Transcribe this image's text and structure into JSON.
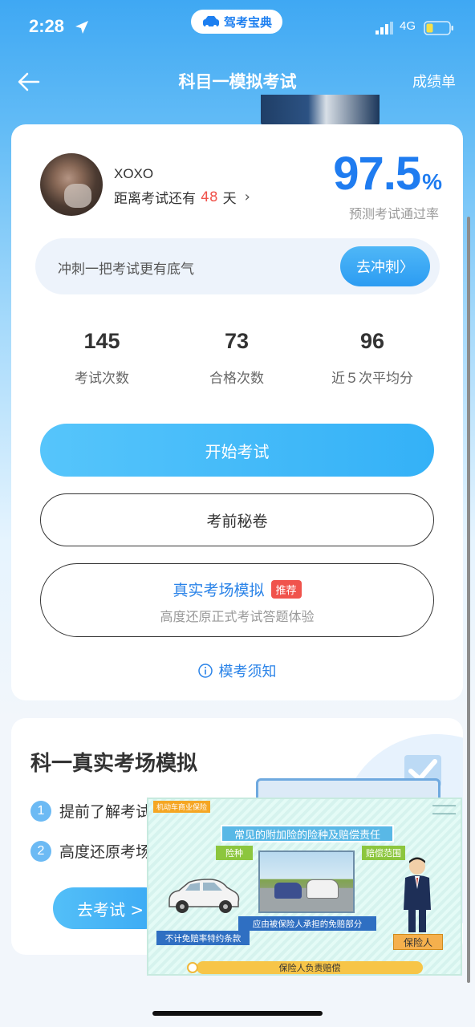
{
  "status_bar": {
    "time": "2:28",
    "network": "4G",
    "app_badge": "驾考宝典"
  },
  "nav": {
    "title": "科目一模拟考试",
    "right": "成绩单"
  },
  "profile": {
    "name": "XOXO",
    "days_prefix": "距离考试还有",
    "days": "48",
    "days_suffix": "天",
    "rate": "97.5",
    "rate_unit": "%",
    "rate_label": "预测考试通过率"
  },
  "sprint": {
    "text": "冲刺一把考试更有底气",
    "button": "去冲刺〉"
  },
  "stats": [
    {
      "value": "145",
      "label": "考试次数"
    },
    {
      "value": "73",
      "label": "合格次数"
    },
    {
      "value": "96",
      "label": "近５次平均分"
    }
  ],
  "buttons": {
    "start": "开始考试",
    "secret": "考前秘卷",
    "real_title": "真实考场模拟",
    "real_badge": "推荐",
    "real_sub": "高度还原正式考试答题体验",
    "notice": "模考须知"
  },
  "card2": {
    "title": "科一真实考场模拟",
    "features": [
      {
        "num": "1",
        "text": "提前了解考试"
      },
      {
        "num": "2",
        "text": "高度还原考场"
      }
    ],
    "go_button": "去考试 >"
  },
  "video": {
    "tag": "机动车商业保险",
    "title": "常见的附加险的险种及赔偿责任",
    "label_type": "险种",
    "label_scope": "赔偿范围",
    "label_duty": "应由被保险人承担的免赔部分",
    "label_clause": "不计免赔率特约条款",
    "label_insured": "保险人",
    "bottom": "保险人负责赔偿"
  },
  "colors": {
    "accent": "#1f7cf0",
    "primary_button": "#3fb5f7",
    "highlight_red": "#f0534c"
  }
}
